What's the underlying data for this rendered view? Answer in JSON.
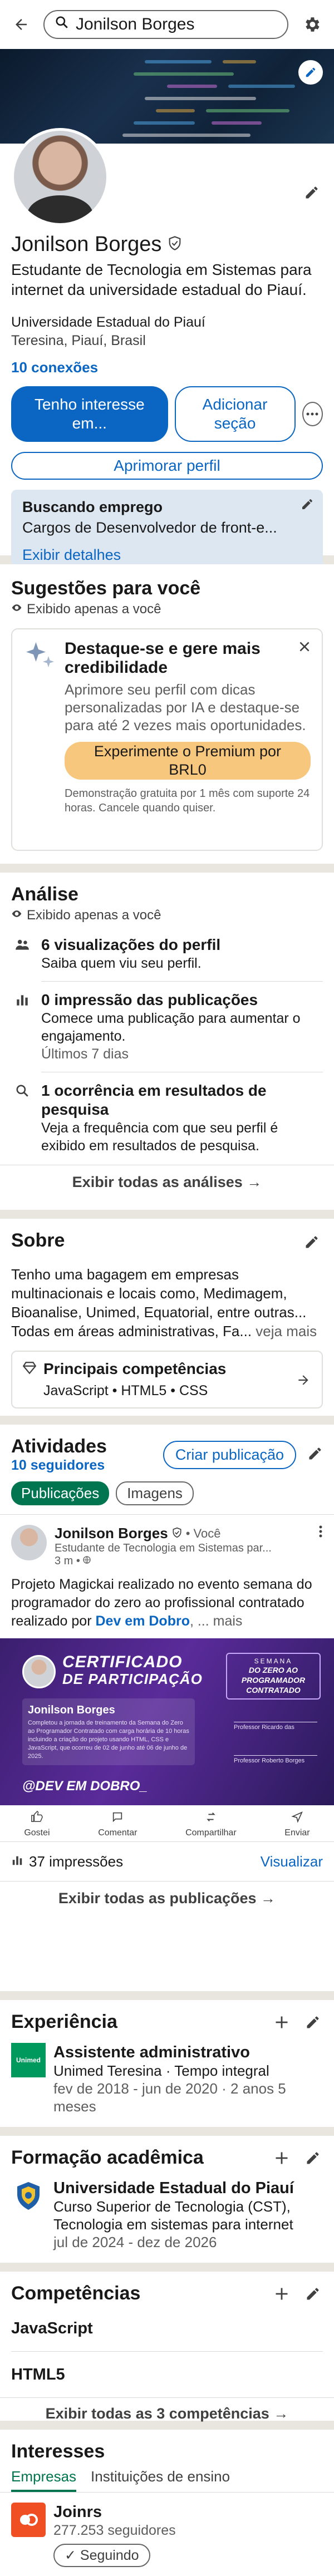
{
  "search": {
    "value": "Jonilson Borges"
  },
  "profile": {
    "name": "Jonilson Borges",
    "headline": "Estudante de Tecnologia em Sistemas para internet da universidade estadual do Piauí.",
    "university": "Universidade Estadual do Piauí",
    "location": "Teresina, Piauí, Brasil",
    "connections": "10 conexões",
    "btn_interest": "Tenho interesse em...",
    "btn_add": "Adicionar seção",
    "btn_improve": "Aprimorar perfil",
    "otw_title": "Buscando emprego",
    "otw_desc": "Cargos de Desenvolvedor de front-e...",
    "otw_link": "Exibir detalhes"
  },
  "suggestions": {
    "title": "Sugestões para você",
    "private": "Exibido apenas a você",
    "card_title": "Destaque-se e gere mais credibilidade",
    "card_desc": "Aprimore seu perfil com dicas personalizadas por IA e destaque-se para até 2 vezes mais oportunidades.",
    "premium_btn": "Experimente o Premium por BRL0",
    "fine_print": "Demonstração gratuita por 1 mês com suporte 24 horas. Cancele quando quiser."
  },
  "analytics": {
    "title": "Análise",
    "private": "Exibido apenas a você",
    "items": [
      {
        "title": "6 visualizações do perfil",
        "desc": "Saiba quem viu seu perfil.",
        "extra": ""
      },
      {
        "title": "0 impressão das publicações",
        "desc": "Comece uma publicação para aumentar o engajamento.",
        "extra": "Últimos 7 dias"
      },
      {
        "title": "1 ocorrência em resultados de pesquisa",
        "desc": "Veja a frequência com que seu perfil é exibido em resultados de pesquisa.",
        "extra": ""
      }
    ],
    "show_all": "Exibir todas as análises →"
  },
  "about": {
    "title": "Sobre",
    "text": "Tenho uma bagagem em empresas multinacionais e locais como, Medimagem, Bioanalise, Unimed, Equatorial, entre outras... Todas em áreas administrativas, Fa...",
    "more": "veja mais",
    "skills_title": "Principais competências",
    "skills": "JavaScript • HTML5 • CSS"
  },
  "activity": {
    "title": "Atividades",
    "followers": "10 seguidores",
    "create_btn": "Criar publicação",
    "tab_posts": "Publicações",
    "tab_images": "Imagens",
    "post_author": "Jonilson Borges",
    "post_you": "• Você",
    "post_sub": "Estudante de Tecnologia em Sistemas par...",
    "post_time": "3 m •",
    "post_text": "Projeto Magickai realizado no evento semana do programador do zero ao profissional contratado realizado por",
    "post_link": "Dev em Dobro",
    "post_more": ", ... mais",
    "cert_title_1": "CERTIFICADO",
    "cert_title_2": "DE PARTICIPAÇÃO",
    "cert_name": "Jonilson Borges",
    "cert_body": "Completou a jornada de treinamento da Semana do Zero ao Programador Contratado com carga horária de 10 horas incluindo a criação do projeto usando HTML, CSS e JavaScript, que ocorreu de 02 de junho até 06 de junho de 2025.",
    "cert_week": "SEMANA",
    "cert_week_sub": "DO ZERO AO PROGRAMADOR CONTRATADO",
    "cert_sig1": "Professor Ricardo das",
    "cert_sig2": "Professor Roberto Borges",
    "cert_brand": "@DEV EM DOBRO_",
    "act_like": "Gostei",
    "act_comment": "Comentar",
    "act_share": "Compartilhar",
    "act_send": "Enviar",
    "impressions": "37 impressões",
    "view": "Visualizar",
    "show_all": "Exibir todas as publicações →"
  },
  "experience": {
    "title": "Experiência",
    "role": "Assistente administrativo",
    "company": "Unimed Teresina · Tempo integral",
    "dates": "fev de 2018 - jun de 2020 · 2 anos 5 meses",
    "logo_text": "Unimed"
  },
  "education": {
    "title": "Formação acadêmica",
    "school": "Universidade Estadual do Piauí",
    "degree": "Curso Superior de Tecnologia (CST), Tecnologia em sistemas para internet",
    "dates": "jul de 2024 - dez de 2026"
  },
  "competencies": {
    "title": "Competências",
    "items": [
      "JavaScript",
      "HTML5"
    ],
    "show_all": "Exibir todas as 3 competências →"
  },
  "interests": {
    "title": "Interesses",
    "tab_companies": "Empresas",
    "tab_schools": "Instituições de ensino",
    "company": "Joinrs",
    "followers": "277.253 seguidores",
    "follow_btn": "✓ Seguindo"
  },
  "colors": {
    "brand": "#0a66c2",
    "green": "#01754f",
    "premium": "#f8c77e"
  }
}
